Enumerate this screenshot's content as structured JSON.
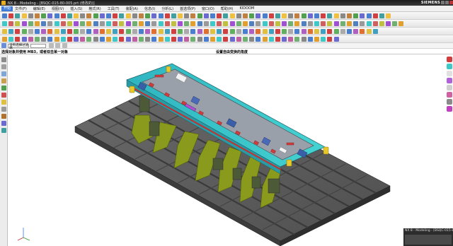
{
  "window": {
    "title": "NX 8 - Modeling - [BSQC-015-80-005.prt  (修改的)]",
    "brand": "SIEMENS"
  },
  "menubar": {
    "start_label": "开始",
    "items": [
      "文件(F)",
      "编辑(E)",
      "视图(V)",
      "插入(S)",
      "格式(R)",
      "工具(T)",
      "装配(A)",
      "信息(I)",
      "分析(L)",
      "首选项(P)",
      "窗口(O)",
      "帮助(H)",
      "KIDOOM"
    ]
  },
  "selection": {
    "filter_value": "没有选择过滤器",
    "scope_value": ""
  },
  "cue": {
    "prompt": "选择对象并使用 MB3，或者双击某一对象",
    "status": "设置自由变换的角度"
  },
  "mini_window": {
    "title": "NX 8 - Modeling - [BSQC-015-80"
  },
  "colors": {
    "plate_teal": "#3fc8c8",
    "fixture_base_gray": "#5a5a5a",
    "support_olive": "#8a9a1c",
    "cad_red": "#d23c3c",
    "accent_blue": "#3d7bd6"
  }
}
